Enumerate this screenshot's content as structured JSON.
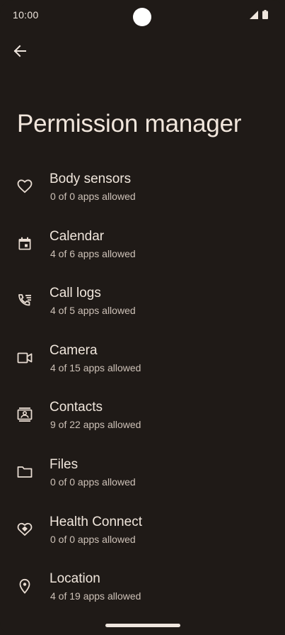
{
  "status_bar": {
    "time": "10:00",
    "icons": [
      "signal-icon",
      "battery-icon"
    ]
  },
  "header": {
    "back_icon": "arrow-back-icon",
    "title": "Permission manager"
  },
  "permissions": [
    {
      "icon": "heart-icon",
      "label": "Body sensors",
      "summary": "0 of 0 apps allowed"
    },
    {
      "icon": "calendar-icon",
      "label": "Calendar",
      "summary": "4 of 6 apps allowed"
    },
    {
      "icon": "call-log-icon",
      "label": "Call logs",
      "summary": "4 of 5 apps allowed"
    },
    {
      "icon": "camera-icon",
      "label": "Camera",
      "summary": "4 of 15 apps allowed"
    },
    {
      "icon": "contacts-icon",
      "label": "Contacts",
      "summary": "9 of 22 apps allowed"
    },
    {
      "icon": "folder-icon",
      "label": "Files",
      "summary": "0 of 0 apps allowed"
    },
    {
      "icon": "health-connect-icon",
      "label": "Health Connect",
      "summary": "0 of 0 apps allowed"
    },
    {
      "icon": "location-pin-icon",
      "label": "Location",
      "summary": "4 of 19 apps allowed"
    }
  ],
  "colors": {
    "background": "#1f1a17",
    "text_primary": "#f0e6dc",
    "text_secondary": "#cdc1b7",
    "icon": "#e8dcd2"
  }
}
